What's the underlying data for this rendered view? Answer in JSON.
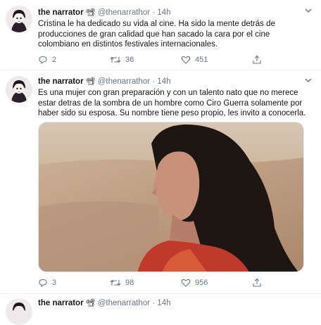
{
  "tweets": [
    {
      "author_name": "the narrator",
      "author_emoji": "📽",
      "handle": "@thenarrathor",
      "separator": "·",
      "time": "14h",
      "text": "Cristina le ha dedicado su vida al cine. Ha sido la mente detrás de producciones de gran calidad que han sacado la cara por el cine colombiano en distintos festivales internacionales.",
      "replies": "2",
      "retweets": "36",
      "likes": "451"
    },
    {
      "author_name": "the narrator",
      "author_emoji": "📽",
      "handle": "@thenarrathor",
      "separator": "·",
      "time": "14h",
      "text": "Es una mujer con gran preparación y con un talento nato que no merece estar detras de la sombra de un hombre como Ciro Guerra solamente por haber sido su esposa. Su nombre tiene peso propio, les invito a conocerla.",
      "replies": "3",
      "retweets": "98",
      "likes": "956"
    },
    {
      "author_name": "the narrator",
      "author_emoji": "📽",
      "handle": "@thenarrathor",
      "separator": "·",
      "time": "14h"
    }
  ],
  "icons": {
    "reply": "reply-icon",
    "retweet": "retweet-icon",
    "like": "heart-icon",
    "share": "share-icon",
    "caret": "chevron-down-icon"
  },
  "colors": {
    "muted": "#657786",
    "text": "#14171a",
    "border": "#e6ecf0"
  }
}
